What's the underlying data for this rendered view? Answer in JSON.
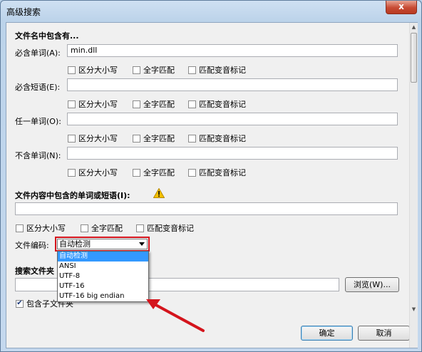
{
  "window": {
    "title": "高级搜索",
    "close_glyph": "x"
  },
  "sections": {
    "filename_heading": "文件名中包含有...",
    "content_heading": "文件内容中包含的单词或短语(I):",
    "folder_heading": "搜索文件夹"
  },
  "filename_rows": [
    {
      "label": "必含单词(A):",
      "value": "min.dll",
      "options": [
        "区分大小写",
        "全字匹配",
        "匹配变音标记"
      ]
    },
    {
      "label": "必含短语(E):",
      "value": "",
      "options": [
        "区分大小写",
        "全字匹配",
        "匹配变音标记"
      ]
    },
    {
      "label": "任一单词(O):",
      "value": "",
      "options": [
        "区分大小写",
        "全字匹配",
        "匹配变音标记"
      ]
    },
    {
      "label": "不含单词(N):",
      "value": "",
      "options": [
        "区分大小写",
        "全字匹配",
        "匹配变音标记"
      ]
    }
  ],
  "content": {
    "value": "",
    "options": [
      "区分大小写",
      "全字匹配",
      "匹配变音标记"
    ],
    "warning_icon": "warning-triangle"
  },
  "encoding": {
    "label": "文件编码:",
    "selected": "自动检测",
    "options": [
      "自动检测",
      "ANSI",
      "UTF-8",
      "UTF-16",
      "UTF-16 big endian"
    ],
    "highlight_color": "#d4141c"
  },
  "folder": {
    "value": "",
    "browse_label": "浏览(W)...",
    "include_subfolders_label": "包含子文件夹",
    "include_subfolders_checked": "✔"
  },
  "buttons": {
    "ok": "确定",
    "cancel": "取消"
  },
  "annotation": {
    "arrow_color": "#d4141c"
  }
}
